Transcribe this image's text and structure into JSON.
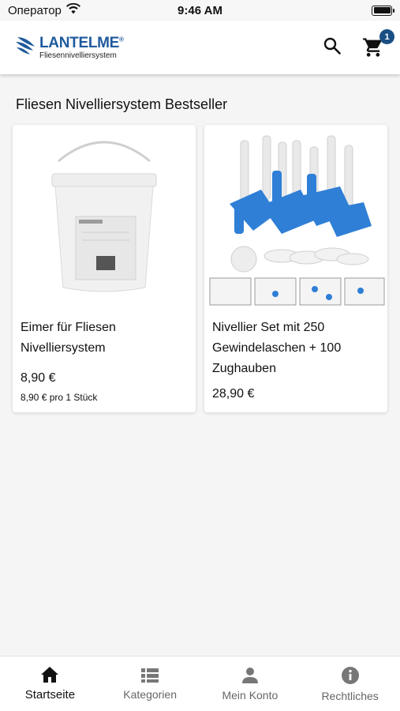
{
  "status_bar": {
    "carrier": "Оператор",
    "time": "9:46 AM"
  },
  "header": {
    "logo_brand": "LANTELME",
    "logo_subtitle": "Fliesennivelliersystem",
    "cart_count": "1",
    "brand_color": "#1f5a9c"
  },
  "section": {
    "title": "Fliesen Nivelliersystem Bestseller"
  },
  "products": [
    {
      "title": "Eimer für Fliesen Nivelliersystem",
      "price": "8,90 €",
      "unit_price": "8,90 € pro 1 Stück"
    },
    {
      "title": "Nivellier Set mit 250 Gewindelaschen + 100 Zughauben",
      "price": "28,90 €"
    }
  ],
  "bottom_nav": {
    "items": [
      {
        "label": "Startseite",
        "icon": "home-icon",
        "active": true
      },
      {
        "label": "Kategorien",
        "icon": "list-icon",
        "active": false
      },
      {
        "label": "Mein Konto",
        "icon": "person-icon",
        "active": false
      },
      {
        "label": "Rechtliches",
        "icon": "info-icon",
        "active": false
      }
    ]
  }
}
